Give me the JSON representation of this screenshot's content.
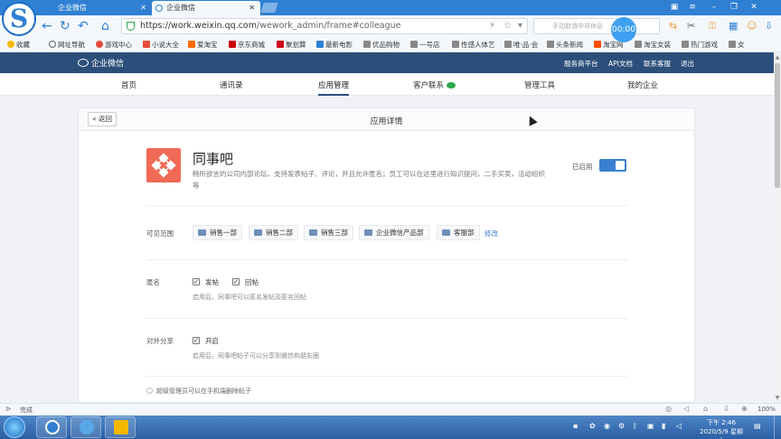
{
  "browser": {
    "tabs": [
      {
        "label": "企业微信",
        "active": false
      },
      {
        "label": "企业微信",
        "active": true
      }
    ],
    "url_host": "https://work.weixin.qq.com",
    "url_path": "/wework_admin/frame#colleague",
    "search_placeholder": "手动取消中非休息",
    "timer": "00:00",
    "bookmarks": [
      "收藏",
      "网址导航",
      "游戏中心",
      "小说大全",
      "爱淘宝",
      "京东商城",
      "聚划算",
      "最新电影",
      "优品购物",
      "一号店",
      "性感人体艺",
      "唯·品·会",
      "头条新闻",
      "淘宝网",
      "淘宝女装",
      "热门游戏",
      "女"
    ],
    "status_text": "完成",
    "zoom": "100%"
  },
  "header": {
    "logo_text": "企业微信",
    "links": [
      "服务商平台",
      "API文档",
      "联系客服",
      "退出"
    ]
  },
  "nav": {
    "items": [
      "首页",
      "通讯录",
      "应用管理",
      "客户联系",
      "管理工具",
      "我的企业"
    ],
    "active": "应用管理"
  },
  "page": {
    "back_label": "« 返回",
    "title": "应用详情",
    "app_name": "同事吧",
    "app_desc": "畅所欲言的公司内部论坛，支持发表帖子、评论，并且允许匿名；员工可以在这里进行知识提问，二手买卖，活动组织等",
    "status_label": "已启用",
    "enabled": true
  },
  "visibility": {
    "label": "可见范围",
    "departments": [
      "销售一部",
      "销售二部",
      "销售三部",
      "企业微信产品部",
      "客服部"
    ],
    "edit_label": "修改"
  },
  "anonymous": {
    "label": "匿名",
    "options": [
      {
        "label": "发帖",
        "checked": true
      },
      {
        "label": "回帖",
        "checked": true
      }
    ],
    "hint": "启用后，同事吧可以匿名发帖及匿名回帖"
  },
  "share": {
    "label": "对外分享",
    "option": {
      "label": "开启",
      "checked": true
    },
    "hint": "启用后，同事吧帖子可以分享到微信和朋友圈"
  },
  "admin_note": "超级管理员可以在手机端删除帖子",
  "taskbar": {
    "time": "下午 2:46",
    "date": "2020/5/9 星期六"
  }
}
